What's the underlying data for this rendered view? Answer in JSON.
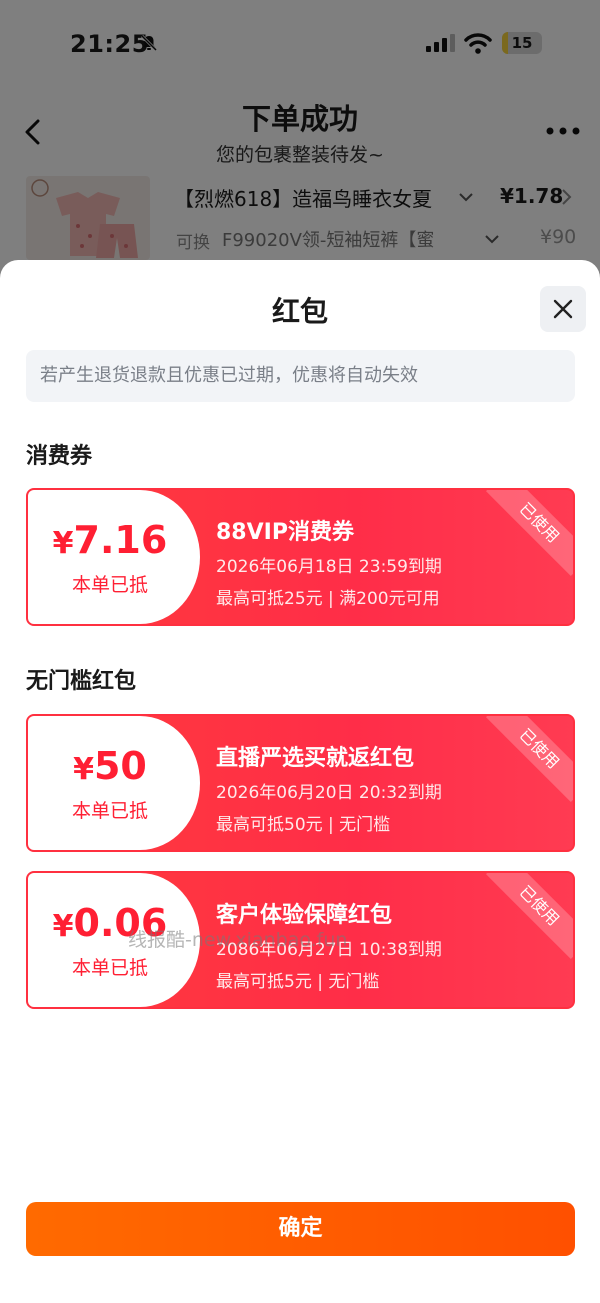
{
  "status_bar": {
    "time": "21:25",
    "battery": "15",
    "battery_level": 0.15
  },
  "background": {
    "title": "下单成功",
    "subtitle": "您的包裹整装待发~",
    "product": {
      "name": "【烈燃618】造福鸟睡衣女夏",
      "price": "¥1.78",
      "swap_label": "可换",
      "spec": "F99020V领-短袖短裤【蜜",
      "original_price": "¥90"
    }
  },
  "sheet": {
    "title": "红包",
    "notice": "若产生退货退款且优惠已过期，优惠将自动失效",
    "section_vouchers": "消费券",
    "section_redpacks": "无门槛红包",
    "coupons": [
      {
        "amount": "7.16",
        "currency": "¥",
        "applied": "本单已抵",
        "name": "88VIP消费券",
        "expiry": "2026年06月18日  23:59到期",
        "rule": "最高可抵25元 | 满200元可用",
        "badge": "已使用"
      },
      {
        "amount": "50",
        "currency": "¥",
        "applied": "本单已抵",
        "name": "直播严选买就返红包",
        "expiry": "2026年06月20日  20:32到期",
        "rule": "最高可抵50元 | 无门槛",
        "badge": "已使用"
      },
      {
        "amount": "0.06",
        "currency": "¥",
        "applied": "本单已抵",
        "name": "客户体验保障红包",
        "expiry": "2086年06月27日  10:38到期",
        "rule": "最高可抵5元 | 无门槛",
        "badge": "已使用"
      }
    ],
    "confirm_label": "确定"
  },
  "watermark": "线报酷-new.xianbao.fun",
  "colors": {
    "accent_red": "#ff1f33",
    "confirm_orange": "#ff5a00",
    "notice_bg": "#f2f4f7"
  },
  "icons": [
    "bell-slash-icon",
    "signal-icon",
    "wifi-icon",
    "back-arrow-icon",
    "more-icon",
    "chevron-down-icon",
    "chevron-right-icon",
    "close-icon"
  ]
}
